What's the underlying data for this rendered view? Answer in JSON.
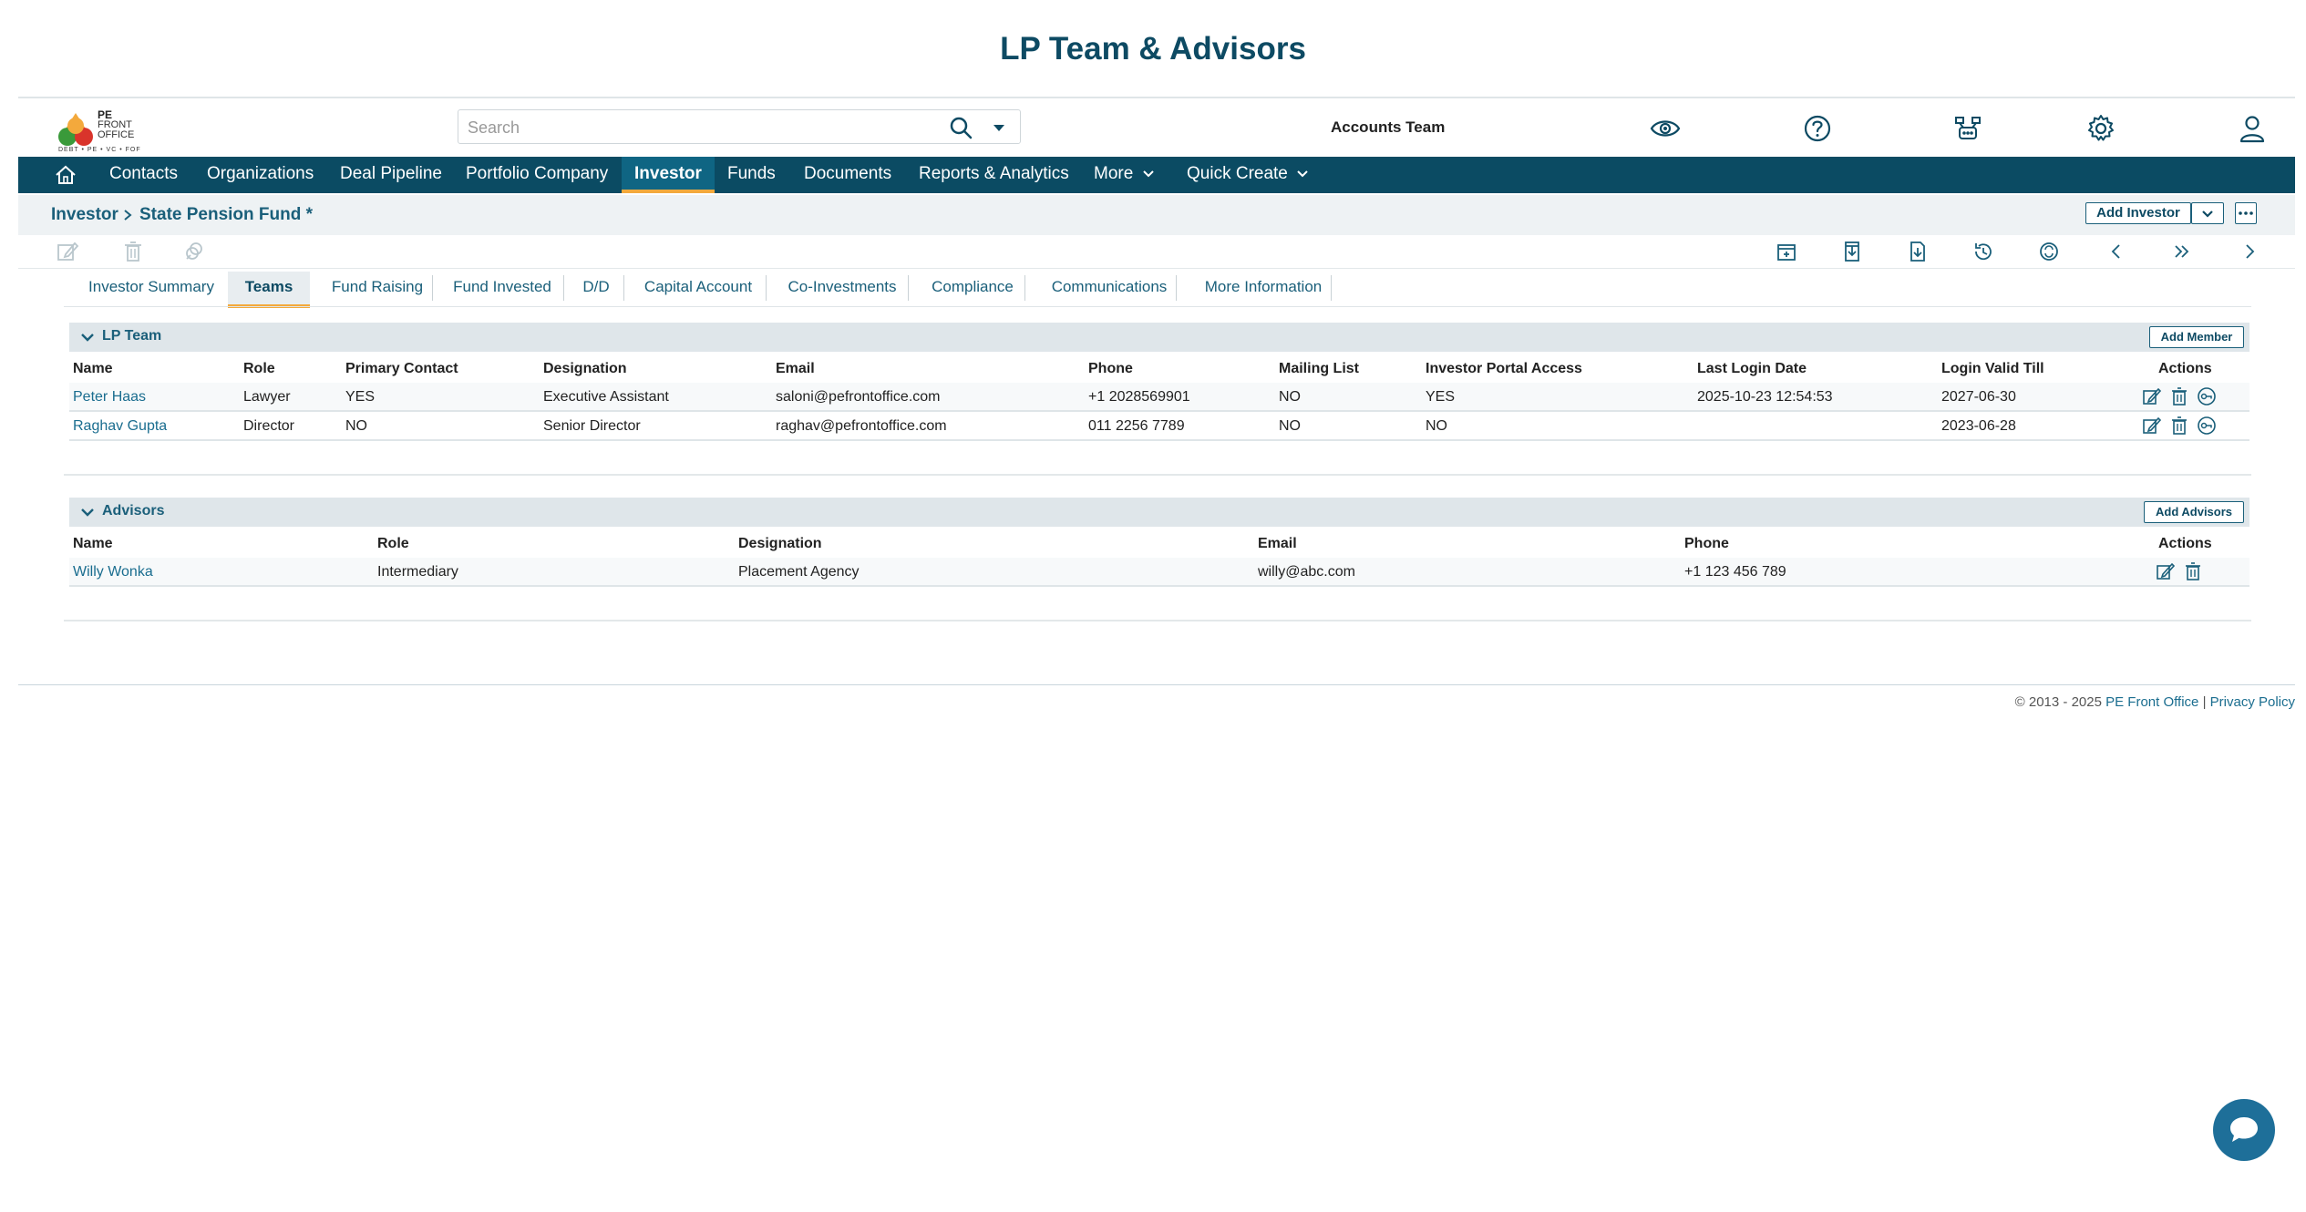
{
  "page_title": "LP Team & Advisors",
  "logo": {
    "line1": "PE",
    "line2": "FRONT OFFICE",
    "tagline": "DEBT • PE • VC • FOF"
  },
  "search": {
    "placeholder": "Search"
  },
  "header": {
    "team": "Accounts Team"
  },
  "nav": {
    "home": "home-icon",
    "items": [
      "Contacts",
      "Organizations",
      "Deal Pipeline",
      "Portfolio Company",
      "Investor",
      "Funds",
      "Documents",
      "Reports & Analytics",
      "More",
      "Quick Create"
    ],
    "active": "Investor"
  },
  "breadcrumb": {
    "root": "Investor",
    "current": "State Pension Fund *"
  },
  "actions": {
    "add_investor": "Add Investor"
  },
  "tabs": [
    "Investor Summary",
    "Teams",
    "Fund Raising",
    "Fund Invested",
    "D/D",
    "Capital Account",
    "Co-Investments",
    "Compliance",
    "Communications",
    "More Information"
  ],
  "active_tab": "Teams",
  "lp_team": {
    "title": "LP Team",
    "add_label": "Add Member",
    "columns": [
      "Name",
      "Role",
      "Primary Contact",
      "Designation",
      "Email",
      "Phone",
      "Mailing List",
      "Investor Portal Access",
      "Last Login Date",
      "Login Valid Till",
      "Actions"
    ],
    "rows": [
      [
        "Peter Haas",
        "Lawyer",
        "YES",
        "Executive Assistant",
        "saloni@pefrontoffice.com",
        "+1 2028569901",
        "NO",
        "YES",
        "2025-10-23 12:54:53",
        "2027-06-30"
      ],
      [
        "Raghav Gupta",
        "Director",
        "NO",
        "Senior Director",
        "raghav@pefrontoffice.com",
        "011 2256 7789",
        "NO",
        "NO",
        "",
        "2023-06-28"
      ]
    ]
  },
  "advisors": {
    "title": "Advisors",
    "add_label": "Add Advisors",
    "columns": [
      "Name",
      "Role",
      "Designation",
      "Email",
      "Phone",
      "Actions"
    ],
    "rows": [
      [
        "Willy Wonka",
        "Intermediary",
        "Placement Agency",
        "willy@abc.com",
        "+1 123 456 789"
      ]
    ]
  },
  "footer": {
    "copyright": "© 2013 - 2025",
    "company": "PE Front Office",
    "sep": "|",
    "privacy": "Privacy Policy"
  },
  "colors": {
    "brand": "#0b4b63",
    "accent": "#f3a93c",
    "link": "#1a6d8f"
  }
}
